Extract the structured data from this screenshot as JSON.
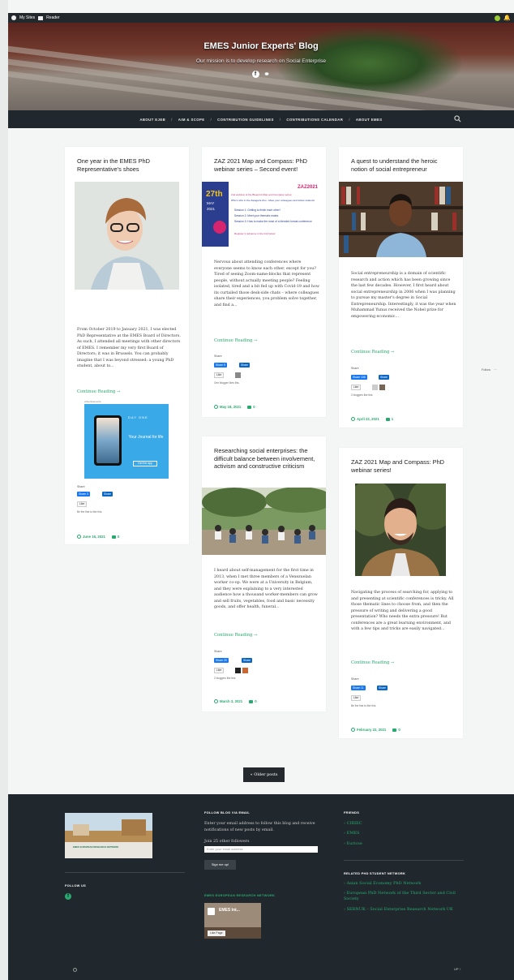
{
  "admin_bar": {
    "my_sites": "My Sites",
    "reader": "Reader"
  },
  "header": {
    "title": "EMES Junior Experts' Blog",
    "description": "Our mission is to develop research on Social Enterprise"
  },
  "nav": {
    "items": [
      "ABOUT EJEB",
      "AIM & SCOPE",
      "CONTRIBUTION GUIDELINES",
      "CONTRIBUTIONS CALENDAR",
      "ABOUT EMES"
    ]
  },
  "posts": [
    {
      "title": "One year in the EMES PhD Representative's shoes",
      "excerpt": "From October 2019 to January 2021, I was elected PhD Representative at the EMES Board of Directors. As such, I attended all meetings with other directors of EMES. I remember my very first Board of Directors; it was in Brussels. You can probably imagine that I was beyond stressed: a young PhD student, about to...",
      "more": "Continue Reading →",
      "share_label": "Share",
      "fb_label": "Share 3",
      "li_label": "Share",
      "like_label": "Like",
      "likes_note": "Be the first to like this.",
      "date": "June 16, 2021",
      "comments": "0"
    },
    {
      "title": "ZAZ 2021 Map and Compass: PhD webinar series – Second event!",
      "excerpt": "Nervous about attending conferences where everyone seems to know each other, except for you? Tired of seeing Zoom-name-blocks that represent people, without actually meeting people? Feeling isolated, tired and a bit fed up with Covid-19 and how its curtailed those desk-side chats – where colleagues share their experiences, you problem solve together, and find a...",
      "more": "Continue Reading →",
      "share_label": "Share",
      "fb_label": "Share 5",
      "li_label": "Share",
      "like_label": "Like",
      "likes_note": "One blogger likes this.",
      "date": "May 18, 2021",
      "comments": "0",
      "flyer": {
        "date_big": "27th",
        "month": "MAY",
        "year": "2021",
        "brand": "ZAZ2021",
        "line1": "2nd webinar of the Blueprint Map and Compass series:",
        "line2": "Who's who in the Zaragoza Zoo - Meet your colleagues and fellow students",
        "s1": "Session 1: Getting to finish each other!",
        "s2": "Session 2: Meet your thematic mates",
        "s3": "Session 3: How to make the most of a blended format conference",
        "reg": "Register in advance in the link below:"
      }
    },
    {
      "title": "A quest to understand the heroic notion of social entrepreneur",
      "excerpt": "Social entrepreneurship is a domain of scientific research and action which has been growing since the last few decades. However, I first heard about social entrepreneurship in 2006 when I was planning to pursue my master's degree in Social Entrepreneurship. Interestingly, it was the year when Muhammad Yunus received the Nobel prize for empowering economic...",
      "more": "Continue Reading →",
      "share_label": "Share",
      "fb_label": "Share 108",
      "li_label": "Share",
      "like_label": "Like",
      "likes_note": "2 bloggers like this.",
      "date": "April 22, 2021",
      "comments": "1"
    },
    {
      "title": "Researching social enterprises: the difficult balance between involvement, activism and constructive criticism",
      "excerpt": "I heard about self-management for the first time in 2013, when I met three members of a Venezuelan worker co-op. We were at a University in Belgium, and they were explaining to a very interested audience how a thousand worker-members can grow and sell fruits, vegetables, food and basic necessity goods, and offer health, funeral...",
      "more": "Continue Reading →",
      "share_label": "Share",
      "fb_label": "Share 20",
      "li_label": "Share",
      "like_label": "Like",
      "likes_note": "2 bloggers like this.",
      "date": "March 3, 2021",
      "comments": "0"
    },
    {
      "title": "ZAZ 2021 Map and Compass: PhD webinar series!",
      "excerpt": "Navigating the process of searching for, applying to and presenting at scientific conferences is tricky. All those thematic lines to choose from, and then the pressure of writing and delivering a good presentation? Who needs the extra pressure! But conferences are a great learning environment, and with a few tips and tricks are easily navigated...",
      "more": "Continue Reading →",
      "share_label": "Share",
      "fb_label": "Share 11",
      "li_label": "Share",
      "like_label": "Like",
      "likes_note": "Be the first to like this.",
      "date": "February 22, 2021",
      "comments": "0"
    }
  ],
  "app_promo": {
    "brand": "DAY ONE",
    "headline": "Your Journal for life",
    "cta": "Get the app",
    "caption": "Advertisements"
  },
  "older_posts": "« Older posts",
  "follow_float": {
    "label": "Follow",
    "more": "···"
  },
  "footer": {
    "follow_us": "FOLLOW US",
    "follow_blog_title": "FOLLOW BLOG VIA EMAIL",
    "follow_blog_text": "Enter your email address to follow this blog and receive notifications of new posts by email.",
    "followers": "Join 25 other followers",
    "email_placeholder": "Enter your email address",
    "sign_up": "Sign me up!",
    "emes_network": "EMES EUROPEAN RESEARCH NETWORK",
    "emes_page_name": "EMES Int...",
    "emes_like": "Like Page",
    "friends_title": "FRIENDS",
    "friends": [
      "CIRIEC",
      "EMES",
      "Euricse"
    ],
    "related_title": "RELATED PHD STUDENT NETWORK",
    "related": [
      "Asian Social Economy PhD Network",
      "European PhD Network of the Third Sector and Civil Society",
      "SERNUK – Social Enterprise Research Network UK"
    ],
    "footer_badge": "EMES EUROPEAN RESEARCH NETWORK",
    "copyright_right": "UP ↑"
  },
  "colors": {
    "accent": "#27aa6f",
    "nav_bg": "#21282d",
    "page_bg": "#f4f5f5"
  }
}
